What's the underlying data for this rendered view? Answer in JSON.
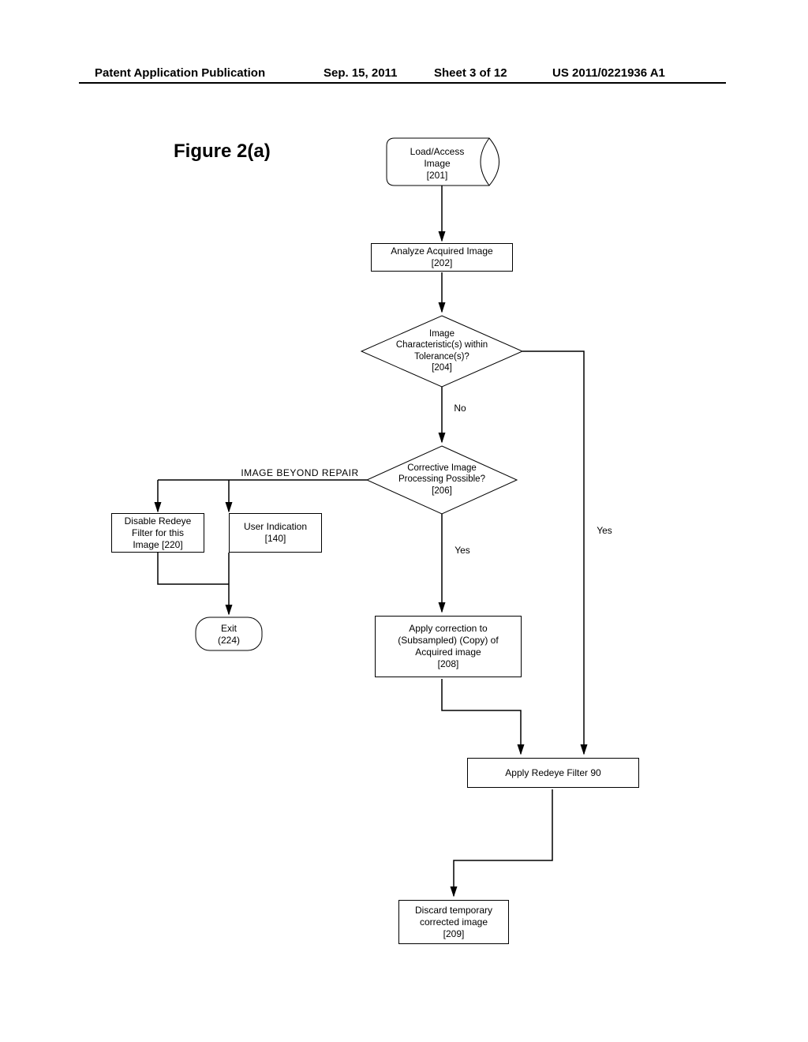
{
  "header": {
    "left": "Patent Application Publication",
    "date": "Sep. 15, 2011",
    "sheet": "Sheet 3 of 12",
    "pubno": "US 2011/0221936 A1"
  },
  "figure_title": "Figure 2(a)",
  "nodes": {
    "load": "Load/Access\nImage\n[201]",
    "analyze": "Analyze Acquired Image\n[202]",
    "tolerance": "Image\nCharacteristic(s) within\nTolerance(s)?\n[204]",
    "corrective": "Corrective Image\nProcessing Possible?\n[206]",
    "beyond_repair": "IMAGE BEYOND REPAIR",
    "disable": "Disable Redeye\nFilter  for this\nImage [220]",
    "user_ind": "User Indication\n[140]",
    "exit": "Exit\n(224)",
    "apply_corr": "Apply correction to\n(Subsampled) (Copy) of\nAcquired image\n[208]",
    "apply_filter": "Apply Redeye Filter   90",
    "discard": "Discard temporary\ncorrected image\n[209]"
  },
  "labels": {
    "no": "No",
    "yes1": "Yes",
    "yes2": "Yes"
  }
}
